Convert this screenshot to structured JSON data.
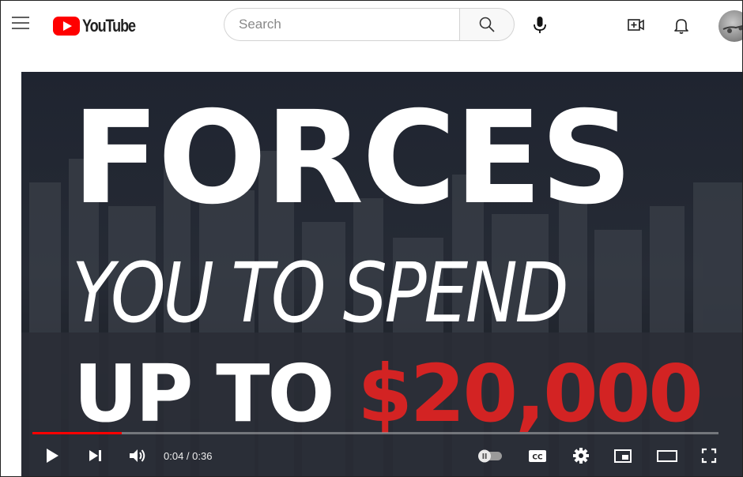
{
  "masthead": {
    "logo_text": "YouTube",
    "search_placeholder": "Search",
    "icons": {
      "menu": "menu-icon",
      "search": "search-icon",
      "mic": "microphone-icon",
      "create": "create-video-icon",
      "notifications": "bell-icon",
      "avatar": "avatar"
    }
  },
  "video": {
    "thumbnail_text": {
      "line1": "FORCES",
      "line2": "YOU TO SPEND",
      "line3_part1": "UP TO ",
      "line3_part2": "$20,000"
    },
    "progress": 0.13,
    "time_display": "0:04 / 0:36",
    "autoplay_on": false,
    "controls": [
      "play-icon",
      "next-icon",
      "volume-icon",
      "autoplay-toggle",
      "captions-icon",
      "settings-gear-icon",
      "miniplayer-icon",
      "theater-mode-icon",
      "fullscreen-icon"
    ]
  },
  "colors": {
    "brand_red": "#ff0000",
    "money_red": "#d32323",
    "player_bg": "#1b1f27"
  }
}
